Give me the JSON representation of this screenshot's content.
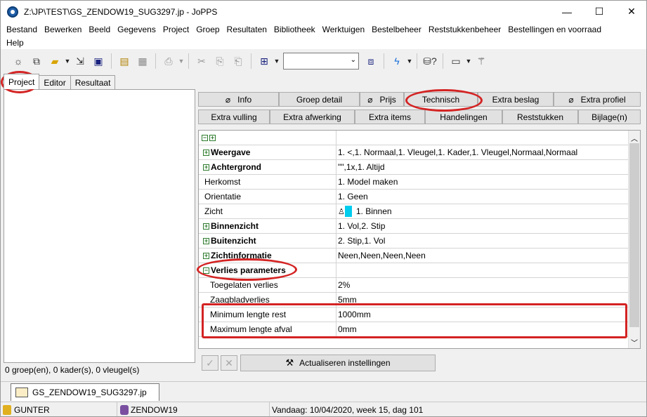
{
  "window": {
    "title": "Z:\\JP\\TEST\\GS_ZENDOW19_SUG3297.jp - JoPPS",
    "minimize": "—",
    "maximize": "☐",
    "close": "✕"
  },
  "menu": {
    "row1": [
      "Bestand",
      "Bewerken",
      "Beeld",
      "Gegevens",
      "Project",
      "Groep",
      "Resultaten",
      "Bibliotheek",
      "Werktuigen",
      "Bestelbeheer",
      "Reststukkenbeheer",
      "Bestellingen en voorraad"
    ],
    "row2": [
      "Help"
    ]
  },
  "toolbar": {
    "combo_value": "",
    "icons": [
      "new-icon",
      "copy-icon",
      "open-folder-icon",
      "import-icon",
      "save-icon",
      "layout-icon",
      "grid-icon",
      "print-icon",
      "cut-icon",
      "paste-icon",
      "paste-special-icon",
      "select-icon",
      "window-icon",
      "lightning-icon",
      "database-help-icon",
      "calendar-icon",
      "magic-wand-icon"
    ]
  },
  "left_tabs": [
    "Project",
    "Editor",
    "Resultaat"
  ],
  "left_status": "0 groep(en), 0 kader(s), 0 vleugel(s)",
  "right_buttons_row1": {
    "info": "Info",
    "groep_detail": "Groep detail",
    "prijs": "Prijs",
    "technisch": "Technisch",
    "extra_beslag": "Extra beslag",
    "extra_profiel": "Extra profiel"
  },
  "right_buttons_row2": {
    "extra_vulling": "Extra vulling",
    "extra_afwerking": "Extra afwerking",
    "extra_items": "Extra items",
    "handelingen": "Handelingen",
    "reststukken": "Reststukken",
    "bijlage": "Bijlage(n)"
  },
  "grid": {
    "rows": [
      {
        "label": "Weergave",
        "value": "1. <,1. Normaal,1. Vleugel,1. Kader,1. Vleugel,Normaal,Normaal"
      },
      {
        "label": "Achtergrond",
        "value": "\"\",1x,1. Altijd"
      },
      {
        "label": "Herkomst",
        "value": "1. Model maken"
      },
      {
        "label": "Orientatie",
        "value": "1. Geen"
      },
      {
        "label": "Zicht",
        "value": "1. Binnen"
      },
      {
        "label": "Binnenzicht",
        "value": "1. Vol,2. Stip"
      },
      {
        "label": "Buitenzicht",
        "value": "2. Stip,1. Vol"
      },
      {
        "label": "Zichtinformatie",
        "value": "Neen,Neen,Neen,Neen"
      },
      {
        "label": "Verlies parameters",
        "value": ""
      },
      {
        "label": "Toegelaten verlies",
        "value": "2%"
      },
      {
        "label": "Zaagbladverlies",
        "value": "5mm"
      },
      {
        "label": "Minimum lengte rest",
        "value": "1000mm"
      },
      {
        "label": "Maximum lengte afval",
        "value": "0mm"
      }
    ]
  },
  "actions": {
    "update_label": "Actualiseren instellingen"
  },
  "doc_tab": "GS_ZENDOW19_SUG3297.jp",
  "status": {
    "user": "GUNTER",
    "db": "ZENDOW19",
    "date": "Vandaag: 10/04/2020, week 15, dag 101"
  },
  "colors": {
    "annotation": "#d42323",
    "highlight": "#00ccee"
  }
}
